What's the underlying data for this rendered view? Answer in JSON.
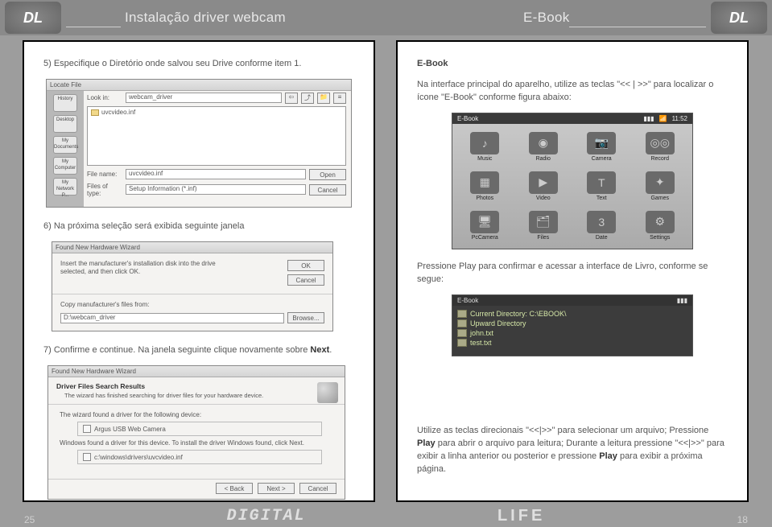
{
  "header": {
    "title_left": "Instalação driver webcam",
    "title_right": "E-Book"
  },
  "left_page": {
    "step5": "5) Especifique o Diretório onde salvou seu Drive conforme item 1.",
    "step6": "6) Na próxima seleção será exibida seguinte janela",
    "step7_a": "7) Confirme e continue. Na janela seguinte clique novamente sobre ",
    "step7_b": "Next",
    "step7_c": ".",
    "locate": {
      "title": "Locate File",
      "lookin_label": "Look in:",
      "lookin_value": "webcam_driver",
      "file_item": "uvcvideo.inf",
      "sidebar": [
        "History",
        "Desktop",
        "My Documents",
        "My Computer",
        "My Network P..."
      ],
      "filename_label": "File name:",
      "filename_value": "uvcvideo.inf",
      "filetype_label": "Files of type:",
      "filetype_value": "Setup Information (*.inf)",
      "open": "Open",
      "cancel": "Cancel"
    },
    "wizard1": {
      "title": "Found New Hardware Wizard",
      "text1": "Insert the manufacturer's installation disk into the drive selected, and then click OK.",
      "ok": "OK",
      "cancel": "Cancel",
      "text2": "Copy manufacturer's files from:",
      "path": "D:\\webcam_driver",
      "browse": "Browse..."
    },
    "wizard2": {
      "title": "Found New Hardware Wizard",
      "header_bold": "Driver Files Search Results",
      "header_sub": "The wizard has finished searching for driver files for your hardware device.",
      "line1": "The wizard found a driver for the following device:",
      "device": "Argus USB Web Camera",
      "line2": "Windows found a driver for this device. To install the driver Windows found, click Next.",
      "path": "c:\\windows\\drivers\\uvcvideo.inf",
      "back": "< Back",
      "next": "Next >",
      "cancel": "Cancel"
    }
  },
  "right_page": {
    "title": "E-Book",
    "intro": "Na interface principal do aparelho, utilize as teclas \"<< | >>\" para localizar o ícone \"E-Book\" conforme figura abaixo:",
    "device1": {
      "status_left": "E-Book",
      "status_right": [
        "📶",
        "11:52"
      ],
      "apps": [
        "Music",
        "Radio",
        "Camera",
        "Record",
        "Photos",
        "Video",
        "Text",
        "Games",
        "PcCamera",
        "Files",
        "Date",
        "Settings"
      ]
    },
    "para2": "Pressione Play para confirmar e acessar a interface de Livro, conforme se segue:",
    "device2": {
      "status_left": "E-Book",
      "line1": "Current Directory: C:\\EBOOK\\",
      "line2": "Upward Directory",
      "line3": "john.txt",
      "line4": "test.txt"
    },
    "bottom_a": "Utilize as teclas direcionais \"<<|>>\" para selecionar um arquivo; Pressione ",
    "bottom_b": "Play",
    "bottom_c": " para abrir o arquivo para leitura; Durante a leitura pressione \"<<|>>\" para exibir a linha anterior ou posterior e pressione ",
    "bottom_d": "Play",
    "bottom_e": " para exibir a próxima página."
  },
  "footer": {
    "pg_left": "25",
    "pg_right": "18",
    "brand_left": "DIGITAL",
    "brand_right": "LIFE"
  }
}
